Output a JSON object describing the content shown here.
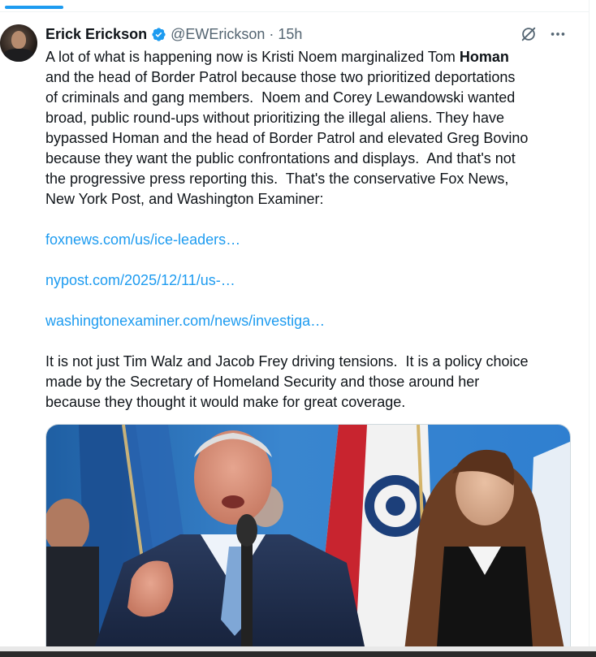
{
  "tweet": {
    "author": {
      "name": "Erick Erickson",
      "handle": "@EWErickson",
      "separator": "·",
      "time": "15h"
    },
    "paragraph1": {
      "part1": "A lot of what is happening now is Kristi Noem marginalized Tom ",
      "bold": "Homan",
      "part2": "\nand the head of Border Patrol because those two prioritized deportations\nof criminals and gang members.  Noem and Corey Lewandowski wanted\nbroad, public round-ups without prioritizing the illegal aliens. They have\nbypassed Homan and the head of Border Patrol and elevated Greg Bovino\nbecause they want the public confrontations and displays.  And that's not\nthe progressive press reporting this.  That's the conservative Fox News,\nNew York Post, and Washington Examiner:"
    },
    "links": [
      "foxnews.com/us/ice-leaders…",
      "nypost.com/2025/12/11/us-…",
      "washingtonexaminer.com/news/investiga…"
    ],
    "paragraph2": "It is not just Tim Walz and Jacob Frey driving tensions.  It is a policy choice\nmade by the Secretary of Homeland Security and those around her\nbecause they thought it would make for great coverage."
  },
  "colors": {
    "accent": "#1d9bf0",
    "text": "#0f1419",
    "secondary": "#536471"
  },
  "icons": {
    "verified": "verified-badge-icon",
    "grok": "grok-icon",
    "more": "more-options-icon"
  }
}
